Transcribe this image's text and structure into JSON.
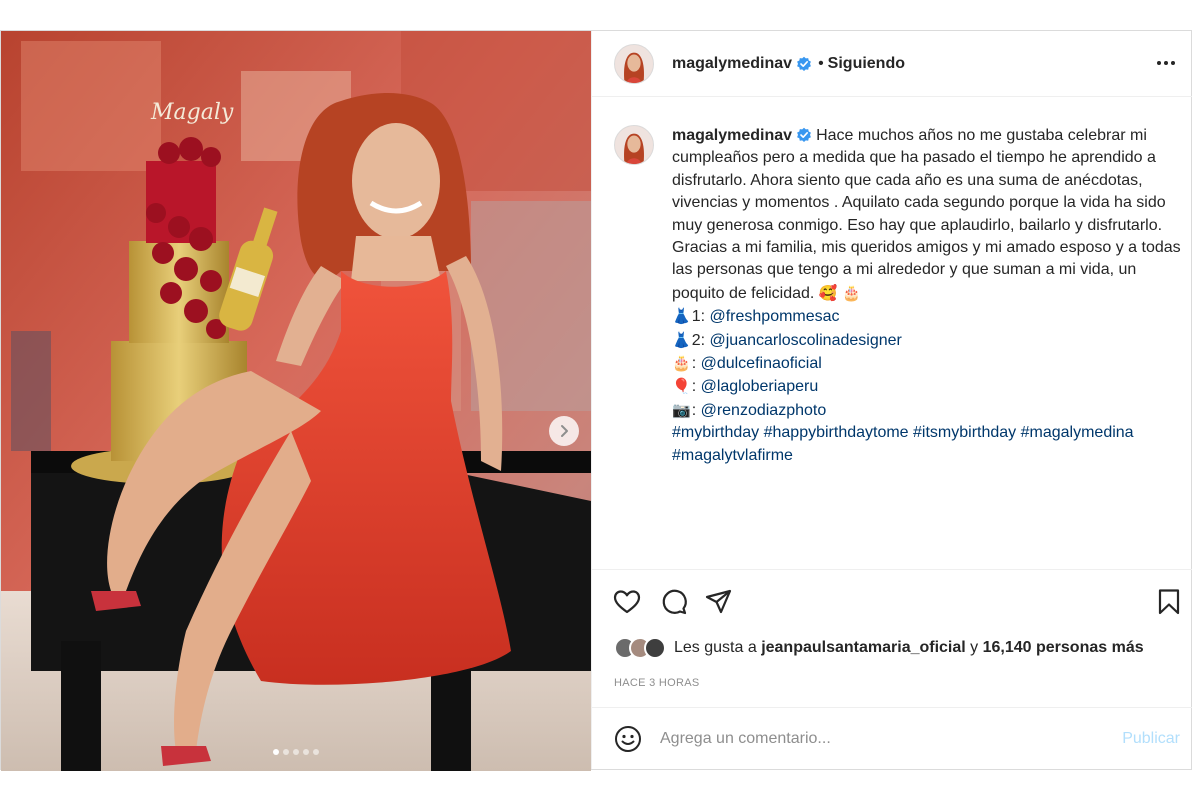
{
  "post": {
    "username": "magalymedinav",
    "separator": "•",
    "follow_status": "Siguiendo",
    "more_icon": "more-horizontal-icon",
    "verified_color": "#3897f0"
  },
  "caption": {
    "username": "magalymedinav",
    "paragraph_1": "Hace muchos años no me gustaba celebrar mi cumpleaños pero a medida que ha pasado el tiempo he aprendido a disfrutarlo. Ahora siento que cada año es una suma de anécdotas, vivencias y momentos . Aquilato cada segundo porque la vida ha sido muy generosa conmigo. Eso hay que aplaudirlo, bailarlo y disfrutarlo.",
    "paragraph_2": "Gracias a mi familia, mis queridos amigos y mi amado esposo y a todas las personas que tengo a mi alrededor y que suman a mi vida, un poquito de felicidad.",
    "paragraph_2_emojis": "🥰 🎂",
    "credits": [
      {
        "emoji": "👗",
        "prefix": "1: ",
        "handle": "@freshpommesac"
      },
      {
        "emoji": "👗",
        "prefix": "2: ",
        "handle": "@juancarloscolinadesigner"
      },
      {
        "emoji": "🎂",
        "prefix": ": ",
        "handle": "@dulcefinaoficial"
      },
      {
        "emoji": "🎈",
        "prefix": ": ",
        "handle": "@lagloberiaperu"
      },
      {
        "emoji": "📷",
        "prefix": ": ",
        "handle": "@renzodiazphoto"
      }
    ],
    "hashtags_line_1": "#mybirthday #happybirthdaytome #itsmybirthday #magalymedina",
    "hashtags_line_2": "#magalytvlafirme"
  },
  "actions": {
    "like_icon": "heart-icon",
    "comment_icon": "comment-icon",
    "share_icon": "send-icon",
    "save_icon": "bookmark-icon"
  },
  "likes": {
    "prefix": "Les gusta a",
    "liked_by": "jeanpaulsantamaria_oficial",
    "connector": "y",
    "others": "16,140 personas más"
  },
  "timestamp": "HACE 3 HORAS",
  "comment": {
    "emoji_icon": "smiley-icon",
    "placeholder": "Agrega un comentario...",
    "post_label": "Publicar"
  },
  "carousel": {
    "slide_count": 5,
    "current_slide": 1,
    "next_icon": "chevron-right-icon",
    "watermark": "Magaly"
  },
  "colors": {
    "link": "#00376b",
    "publish_disabled": "#b2dffc",
    "dress_red": "#e8432d"
  }
}
